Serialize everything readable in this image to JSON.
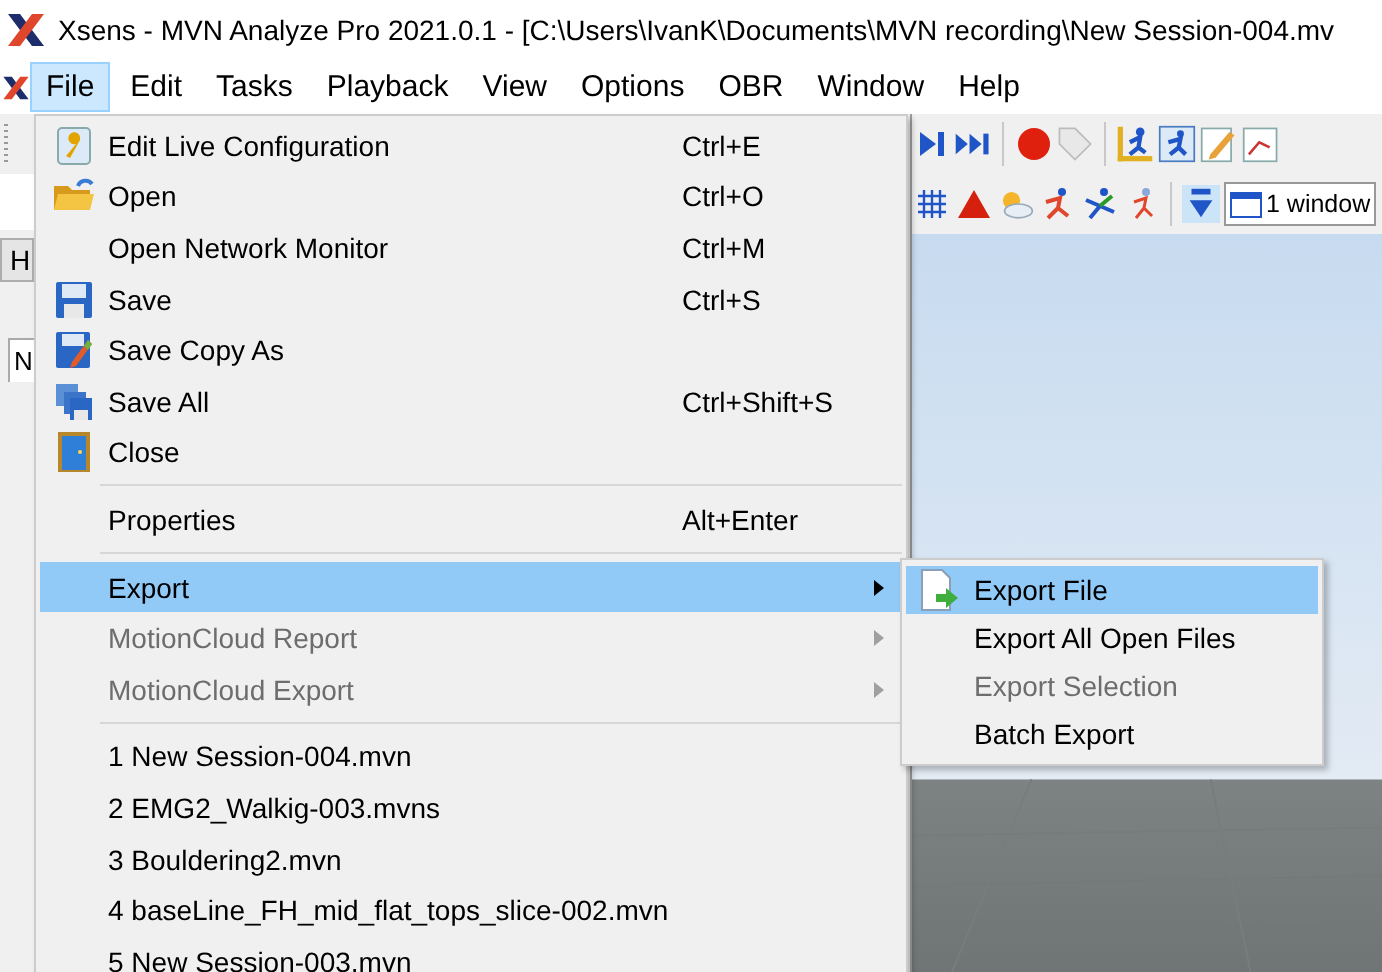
{
  "title_bar": {
    "title": "Xsens - MVN Analyze Pro 2021.0.1 - [C:\\Users\\IvanK\\Documents\\MVN recording\\New Session-004.mv"
  },
  "menu_bar": {
    "items": [
      {
        "label": "File",
        "selected": true
      },
      {
        "label": "Edit",
        "selected": false
      },
      {
        "label": "Tasks",
        "selected": false
      },
      {
        "label": "Playback",
        "selected": false
      },
      {
        "label": "View",
        "selected": false
      },
      {
        "label": "Options",
        "selected": false
      },
      {
        "label": "OBR",
        "selected": false
      },
      {
        "label": "Window",
        "selected": false
      },
      {
        "label": "Help",
        "selected": false
      }
    ]
  },
  "left_panel": {
    "tab": "H",
    "label": "N"
  },
  "view_toolbar": {
    "window_select": "1 window"
  },
  "file_menu": {
    "items": [
      {
        "kind": "item",
        "label": "Edit Live Configuration",
        "shortcut": "Ctrl+E",
        "disabled": false,
        "selected": false
      },
      {
        "kind": "item",
        "label": "Open",
        "shortcut": "Ctrl+O",
        "disabled": false,
        "selected": false
      },
      {
        "kind": "item",
        "label": "Open Network Monitor",
        "shortcut": "Ctrl+M",
        "disabled": false,
        "selected": false
      },
      {
        "kind": "item",
        "label": "Save",
        "shortcut": "Ctrl+S",
        "disabled": false,
        "selected": false
      },
      {
        "kind": "item",
        "label": "Save Copy As",
        "disabled": false,
        "selected": false
      },
      {
        "kind": "item",
        "label": "Save All",
        "shortcut": "Ctrl+Shift+S",
        "disabled": false,
        "selected": false
      },
      {
        "kind": "item",
        "label": "Close",
        "disabled": false,
        "selected": false
      },
      {
        "kind": "separator"
      },
      {
        "kind": "item",
        "label": "Properties",
        "shortcut": "Alt+Enter",
        "disabled": false,
        "selected": false
      },
      {
        "kind": "separator"
      },
      {
        "kind": "submenu",
        "label": "Export",
        "disabled": false,
        "selected": true
      },
      {
        "kind": "submenu",
        "label": "MotionCloud Report",
        "disabled": true,
        "selected": false
      },
      {
        "kind": "submenu",
        "label": "MotionCloud Export",
        "disabled": true,
        "selected": false
      },
      {
        "kind": "separator"
      },
      {
        "kind": "item",
        "label": "1 New Session-004.mvn",
        "disabled": false,
        "selected": false
      },
      {
        "kind": "item",
        "label": "2 EMG2_Walkig-003.mvns",
        "disabled": false,
        "selected": false
      },
      {
        "kind": "item",
        "label": "3 Bouldering2.mvn",
        "disabled": false,
        "selected": false
      },
      {
        "kind": "item",
        "label": "4 baseLine_FH_mid_flat_tops_slice-002.mvn",
        "disabled": false,
        "selected": false
      },
      {
        "kind": "item",
        "label": "5 New Session-003.mvn",
        "disabled": false,
        "selected": false
      }
    ]
  },
  "export_submenu": {
    "items": [
      {
        "label": "Export File",
        "disabled": false,
        "selected": true
      },
      {
        "label": "Export All Open Files",
        "disabled": false,
        "selected": false
      },
      {
        "label": "Export Selection",
        "disabled": true,
        "selected": false
      },
      {
        "label": "Batch Export",
        "disabled": false,
        "selected": false
      }
    ]
  }
}
